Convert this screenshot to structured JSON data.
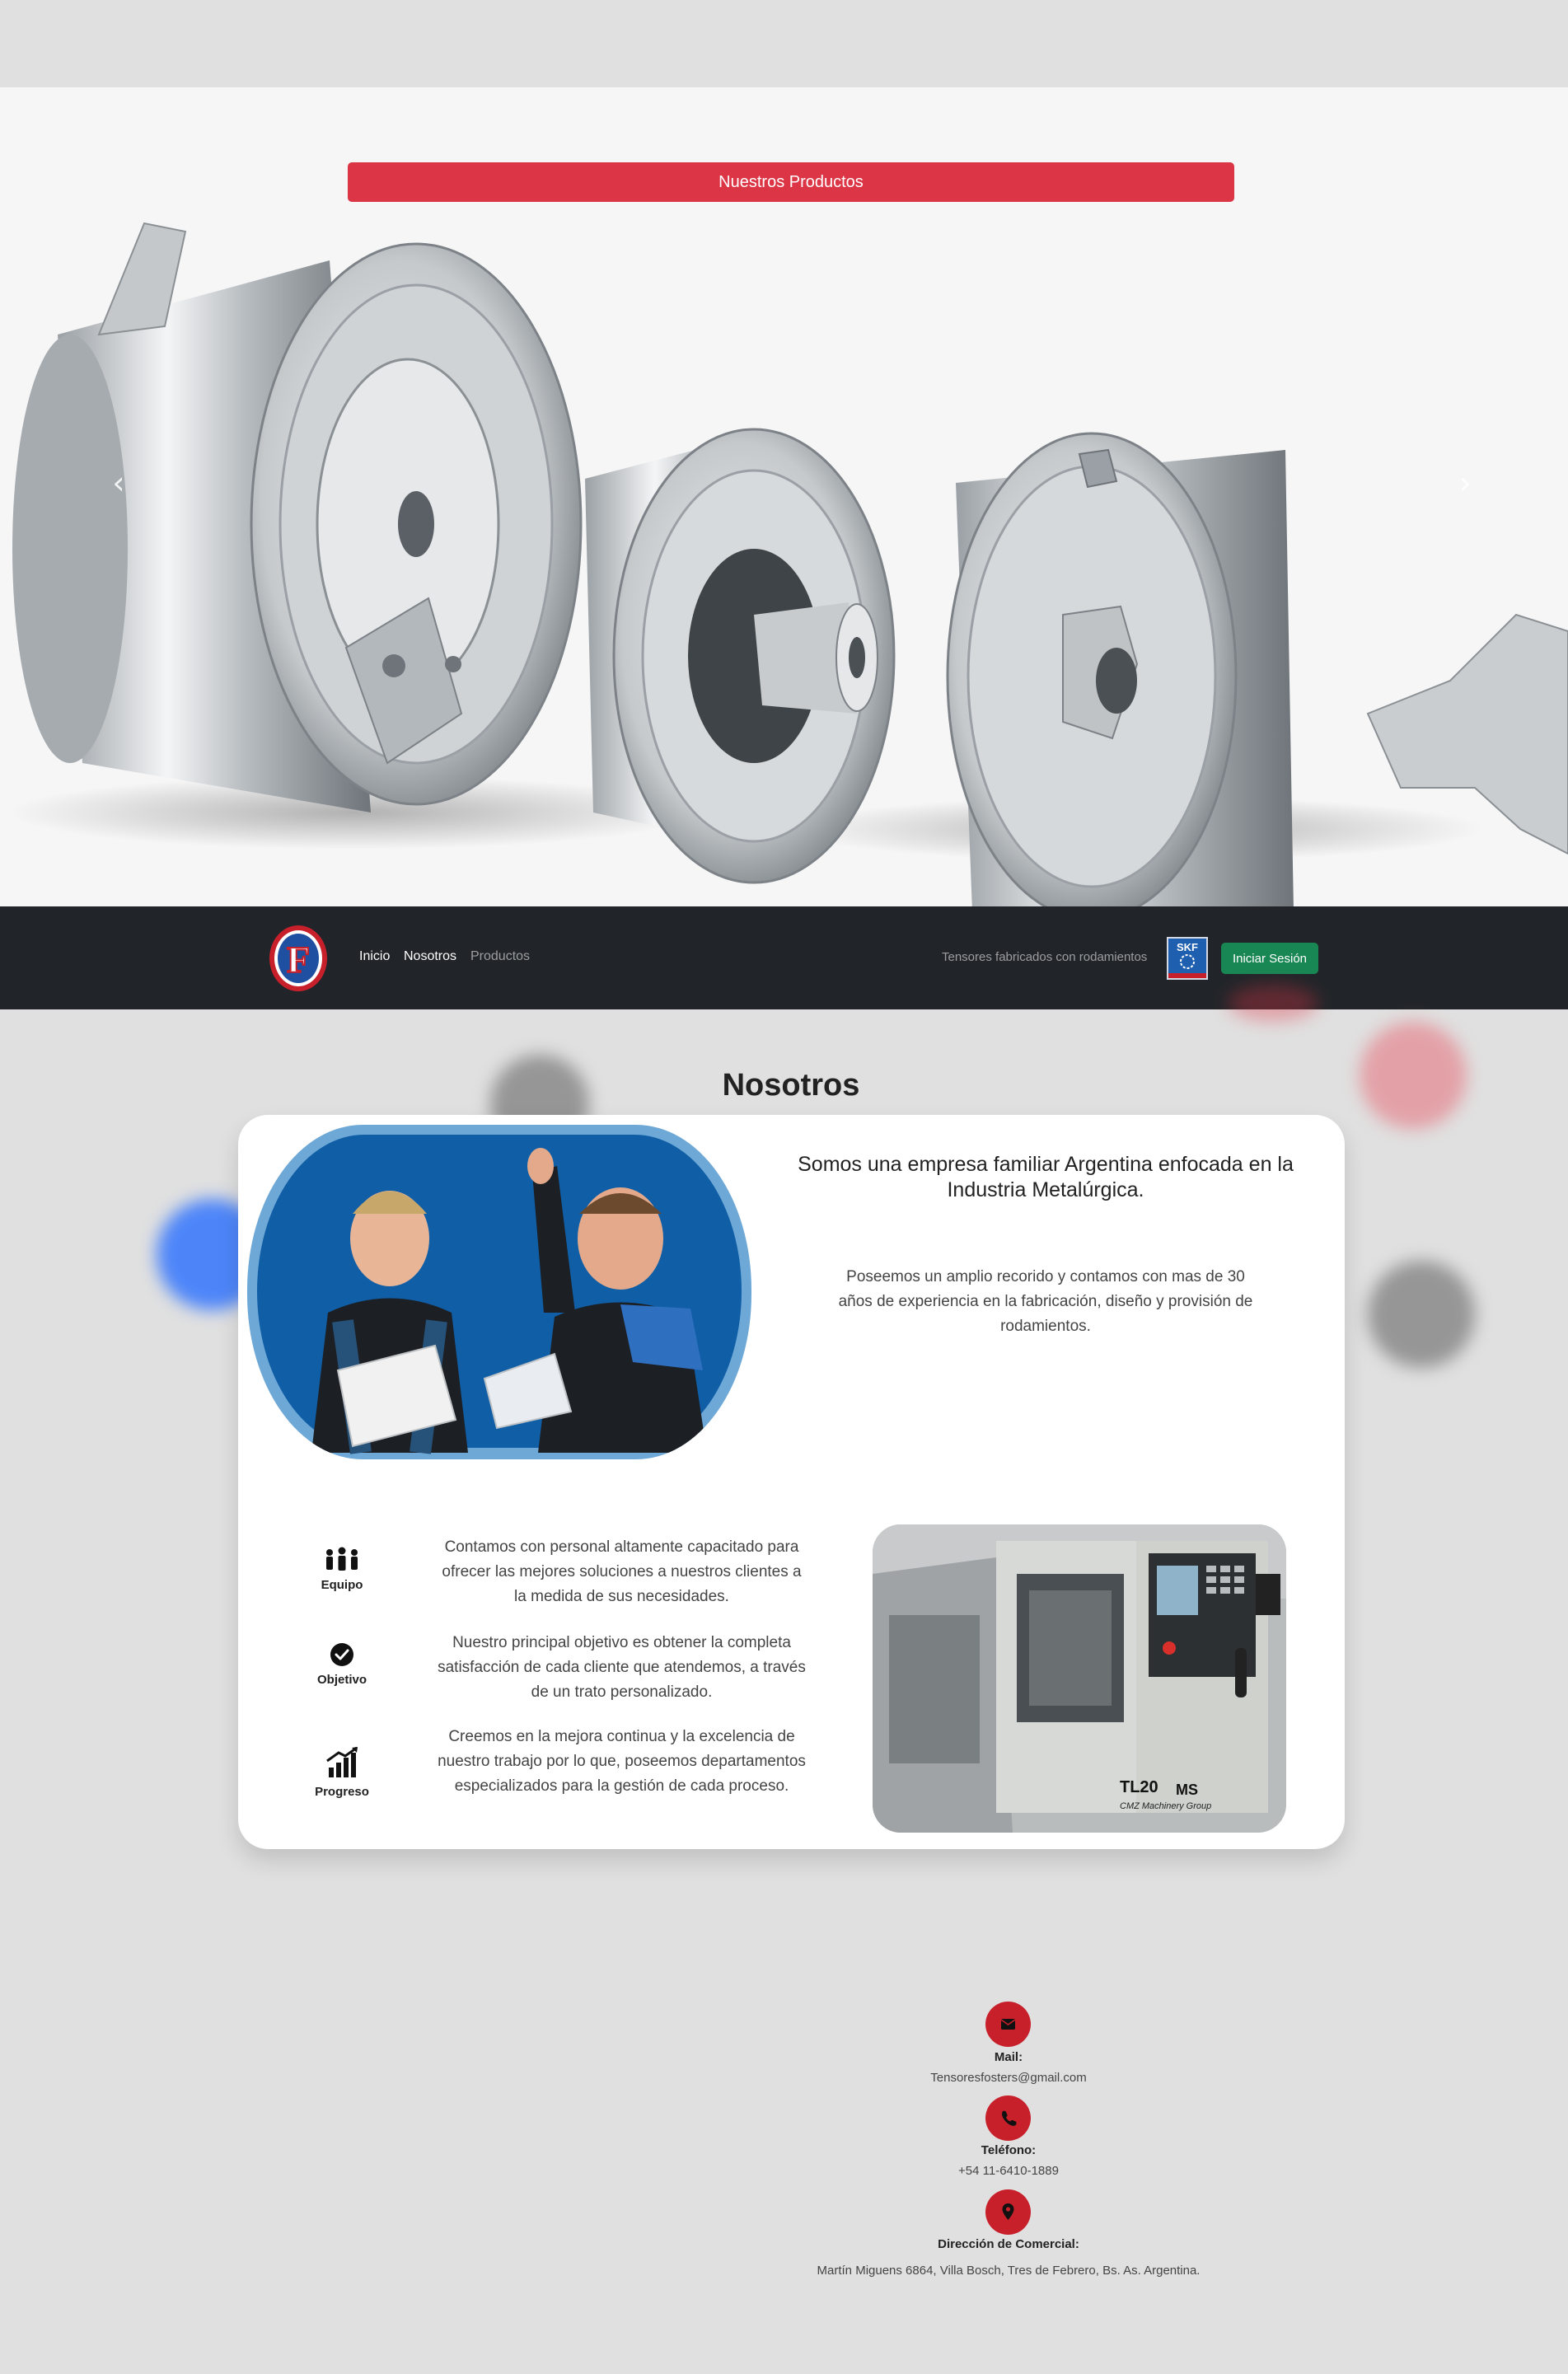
{
  "hero": {
    "cta_label": "Nuestros Productos",
    "prev_glyph": "‹",
    "next_glyph": "›"
  },
  "navbar": {
    "logo_letter": "F",
    "links": [
      {
        "label": "Inicio"
      },
      {
        "label": "Nosotros"
      },
      {
        "label": "Productos"
      }
    ],
    "tagline": "Tensores fabricados con rodamientos",
    "brand_badge": "SKF",
    "login_label": "Iniciar Sesión"
  },
  "about": {
    "title": "Nosotros",
    "headline": "Somos una empresa familiar Argentina enfocada en la Industria Metalúrgica.",
    "lead": "Poseemos un amplio recorido y contamos con mas de 30 años de experiencia en la fabricación, diseño y provisión de rodamientos.",
    "features": [
      {
        "icon": "team-icon",
        "label": "Equipo",
        "text": "Contamos con personal altamente capacitado para ofrecer las mejores soluciones a nuestros clientes a la medida de sus necesidades."
      },
      {
        "icon": "check-circle-icon",
        "label": "Objetivo",
        "text": "Nuestro principal objetivo es obtener la completa satisfacción de cada cliente que atendemos, a través de un trato personalizado."
      },
      {
        "icon": "growth-chart-icon",
        "label": "Progreso",
        "text": "Creemos en la mejora continua y la excelencia de nuestro trabajo por lo que, poseemos departamentos especializados para la gestión de cada proceso."
      }
    ],
    "machine_text_1": "TL20",
    "machine_text_2": "MS",
    "machine_text_3": "CMZ Machinery Group"
  },
  "contact": {
    "items": [
      {
        "icon": "mail-icon",
        "label": "Mail:",
        "value": "Tensoresfosters@gmail.com"
      },
      {
        "icon": "phone-icon",
        "label": "Teléfono:",
        "value": "+54 11-6410-1889"
      },
      {
        "icon": "location-pin-icon",
        "label": "Dirección de Comercial:",
        "value": "Martín Miguens 6864, Villa Bosch, Tres de Febrero, Bs. As. Argentina."
      }
    ]
  },
  "colors": {
    "accent_red": "#dc3545",
    "navbar_bg": "#212529",
    "login_green": "#198754",
    "contact_red": "#c8202b"
  }
}
